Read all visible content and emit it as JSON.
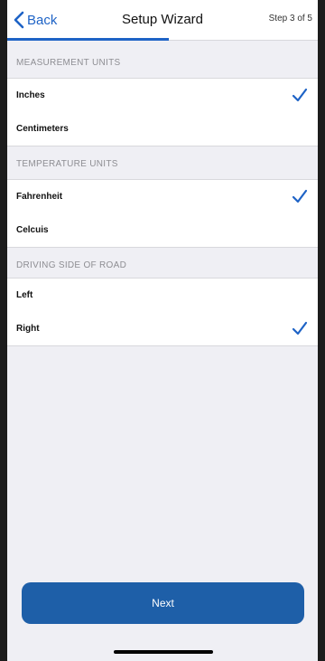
{
  "nav": {
    "back_label": "Back",
    "title": "Setup Wizard",
    "step": "Step 3 of 5",
    "progress": 0.52,
    "accent": "#1e63c6"
  },
  "sections": [
    {
      "header": "MEASUREMENT UNITS",
      "options": [
        {
          "label": "Inches",
          "selected": true
        },
        {
          "label": "Centimeters",
          "selected": false
        }
      ]
    },
    {
      "header": "TEMPERATURE UNITS",
      "options": [
        {
          "label": "Fahrenheit",
          "selected": true
        },
        {
          "label": "Celcuis",
          "selected": false
        }
      ]
    },
    {
      "header": "DRIVING SIDE OF ROAD",
      "options": [
        {
          "label": "Left",
          "selected": false
        },
        {
          "label": "Right",
          "selected": true
        }
      ]
    }
  ],
  "next_button": {
    "label": "Next",
    "color": "#1e5fa8"
  }
}
